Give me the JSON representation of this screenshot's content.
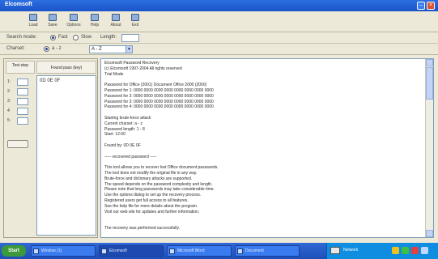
{
  "window": {
    "title": "Elcomsoft"
  },
  "toolbar": {
    "items": [
      {
        "label": "Load",
        "icon": "open-file-icon"
      },
      {
        "label": "Save",
        "icon": "save-icon"
      },
      {
        "label": "Options",
        "icon": "options-icon"
      },
      {
        "label": "Help",
        "icon": "help-icon"
      },
      {
        "label": "About",
        "icon": "info-icon"
      },
      {
        "label": "Exit",
        "icon": "exit-icon"
      }
    ]
  },
  "options_row": {
    "label1": "Search mode:",
    "radio1": "Fast",
    "radio2": "Slow",
    "label2": "Length:",
    "length_value": ""
  },
  "charset_row": {
    "label": "Charset:",
    "option": "a - z",
    "select_value": "A - Z"
  },
  "left_panel": {
    "col1_header": "Test\nstep",
    "col2_header": "Found pass (key)",
    "steps": [
      "1:",
      "2:",
      "3:",
      "4:",
      "5:"
    ],
    "found_item": "0D 0E 0F"
  },
  "right_panel": {
    "lines": [
      "Elcomsoft Password Recovery",
      "(c) Elcomsoft 1997-2004 All rights reserved",
      "Trial Mode",
      "",
      "Password for Office (2001) Document       Office 2000 (2000)",
      "Password for 1: 0000 0000 0000 0000 0000 0000 0000 0000",
      "Password for 2: 0000 0000 0000 0000 0000 0000 0000 0000",
      "Password for 3: 0000 0000 0000 0000 0000 0000 0000 0000",
      "Password for 4: 0000 0000 0000 0000 0000 0000 0000 0000",
      "",
      "Starting brute-force attack",
      "Current charset: a - z",
      "Password length: 1 - 8",
      "Start: 12:00",
      "",
      "Found by: 0D 0E 0F",
      "",
      "          ----- recovered password -----",
      "",
      "This tool allows you to recover lost Office document passwords.",
      "The tool does not modify the original file in any way.",
      "Brute-force and dictionary attacks are supported.",
      "The speed depends on the password complexity and length.",
      "Please note that long passwords may take considerable time.",
      "Use the options dialog to set up the recovery process.",
      "Registered users get full access to all features.",
      "See the help file for more details about the program.",
      "Visit our web site for updates and further information.",
      "",
      "",
      "The recovery was performed successfully."
    ]
  },
  "taskbar": {
    "start_label": "Start",
    "tasks": [
      {
        "label": "Window (1)"
      },
      {
        "label": "Elcomsoft"
      },
      {
        "label": "Microsoft Word"
      },
      {
        "label": "Document"
      }
    ],
    "tray_text": "Network"
  }
}
